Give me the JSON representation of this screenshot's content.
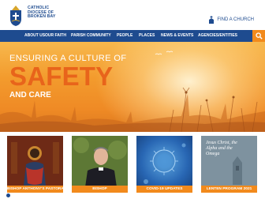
{
  "header": {
    "org_name_lines": [
      "CATHOLIC",
      "DIOCESE OF",
      "BROKEN BAY"
    ],
    "find_church_label": "FIND A CHURCH"
  },
  "nav": {
    "items": [
      "ABOUT US",
      "OUR FAITH",
      "PARISH COMMUNITY",
      "PEOPLE",
      "PLACES",
      "NEWS & EVENTS",
      "AGENCIES/ENTITIES"
    ]
  },
  "hero": {
    "headline": "ENSURING A CULTURE OF",
    "title": "SAFETY",
    "subtitle": "AND CARE"
  },
  "tiles": [
    {
      "caption": "BISHOP ANTHONY'S PASTORAL LETTER",
      "caption_color": "#f28a1c"
    },
    {
      "caption": "BISHOP",
      "caption_color": "#f28a1c"
    },
    {
      "caption": "COVID-19 UPDATES",
      "caption_color": "#f28a1c"
    },
    {
      "caption": "LENTEN PROGRAM 2021",
      "caption_color": "#f28a1c",
      "image_text": "Jesus Christ, the Alpha and the Omega"
    }
  ],
  "colors": {
    "brand_blue": "#1e4b8f",
    "accent_orange": "#f28a1c",
    "safety_orange": "#e8641b"
  }
}
